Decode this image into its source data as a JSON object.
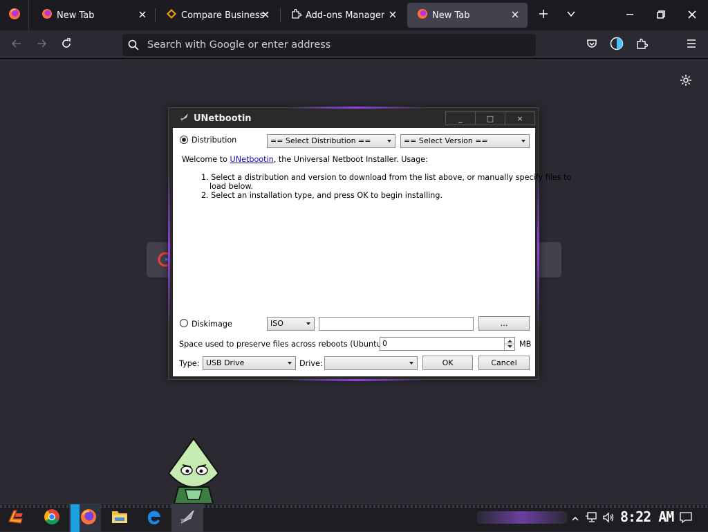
{
  "browser": {
    "tabs": [
      {
        "label": "New Tab",
        "active": false
      },
      {
        "label": "Compare Business Sof",
        "active": false
      },
      {
        "label": "Add-ons Manager",
        "active": false
      },
      {
        "label": "New Tab",
        "active": true
      }
    ],
    "url_placeholder": "Search with Google or enter address"
  },
  "dialog": {
    "title": "UNetbootin",
    "title_controls": [
      "_",
      "□",
      "×"
    ],
    "distribution_label": "Distribution",
    "distribution_select": "== Select Distribution ==",
    "version_select": "== Select Version ==",
    "welcome_prefix": "Welcome to ",
    "welcome_link": "UNetbootin",
    "welcome_suffix": ", the Universal Netboot Installer. Usage:",
    "steps": [
      "1. Select a distribution and version to download from the list above, or manually specify files to",
      "load below.",
      "2. Select an installation type, and press OK to begin installing."
    ],
    "diskimage_label": "Diskimage",
    "diskimage_type": "ISO",
    "diskimage_path": "",
    "browse_label": "...",
    "space_label": "Space used to preserve files across reboots (Ubuntu only):",
    "space_value": "0",
    "space_unit": "MB",
    "type_label": "Type:",
    "type_value": "USB Drive",
    "drive_label": "Drive:",
    "drive_value": "",
    "ok_label": "OK",
    "cancel_label": "Cancel"
  },
  "taskbar": {
    "clock": "8:22 AM"
  }
}
